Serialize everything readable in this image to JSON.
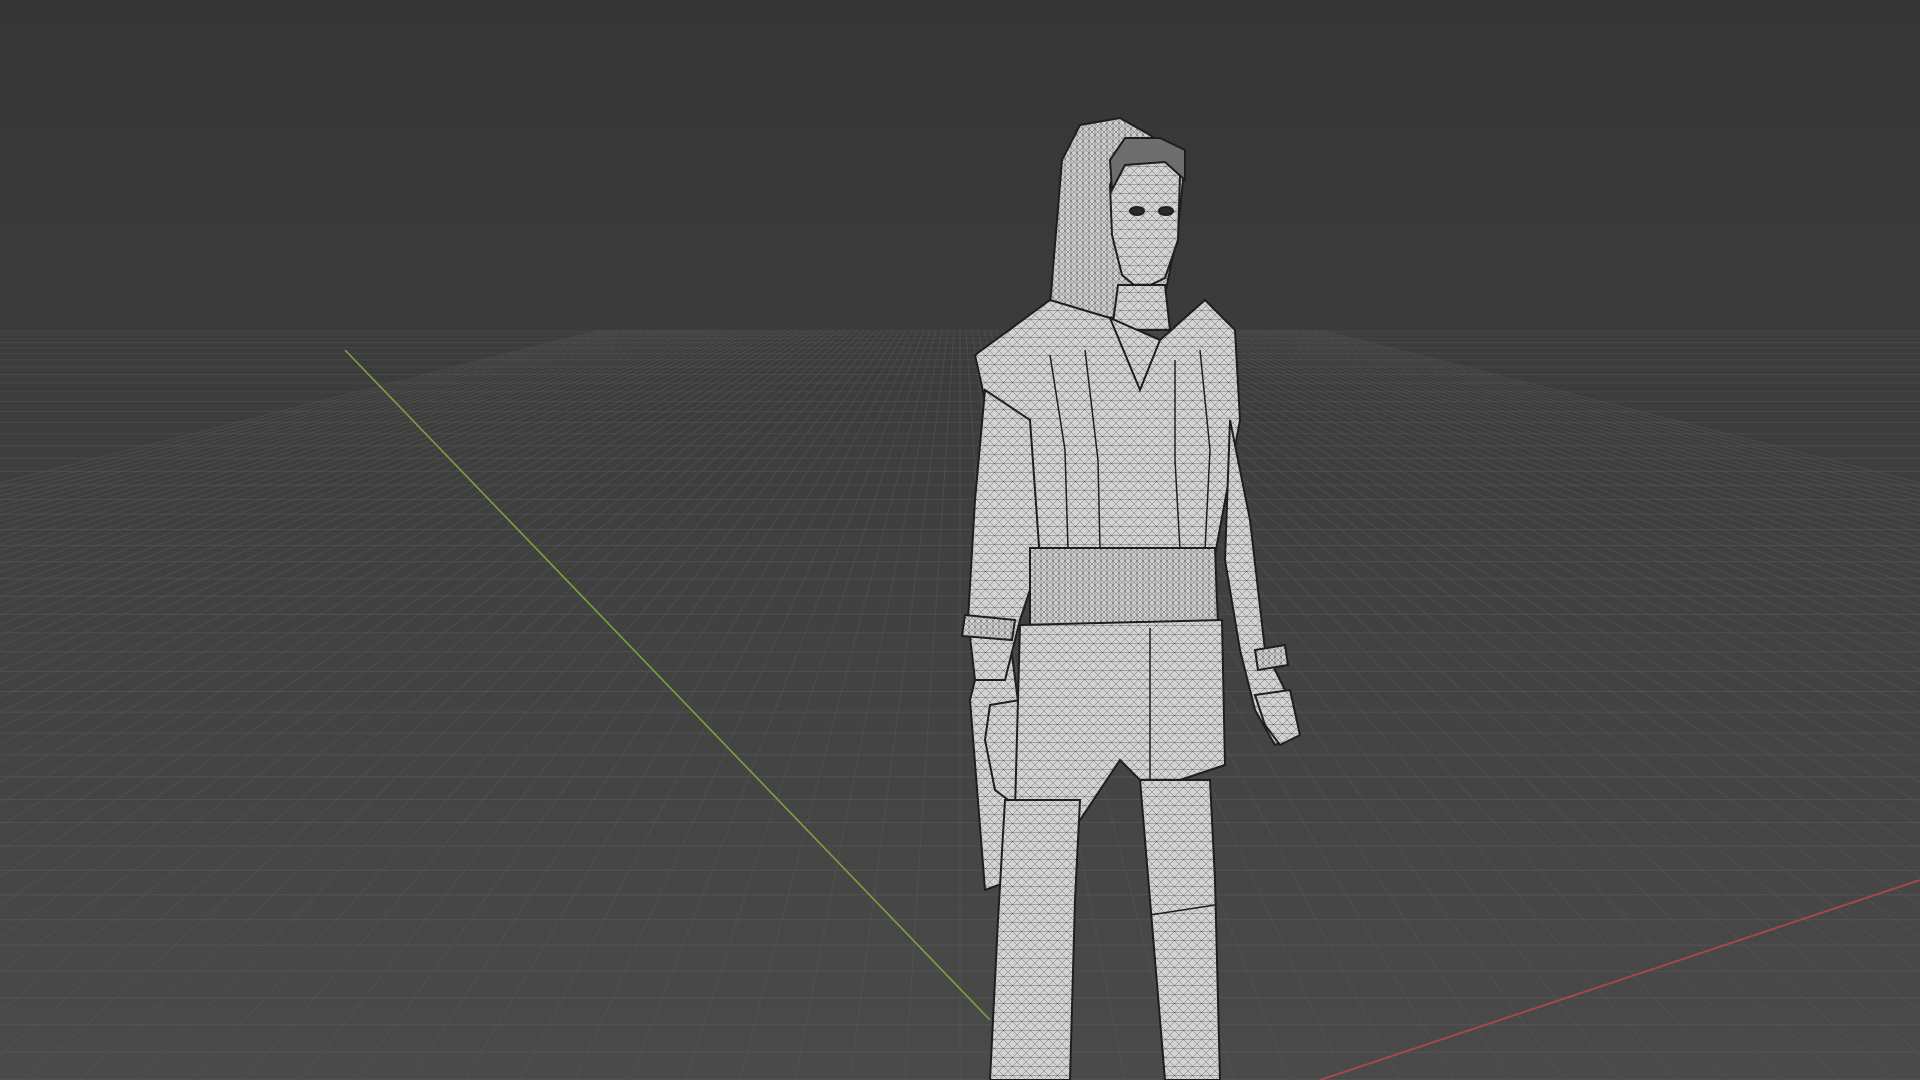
{
  "viewport": {
    "mode": "3d-viewport",
    "shading": "wireframe-overlay",
    "colors": {
      "background_top": "#353535",
      "background_bottom": "#4a4a4a",
      "grid_line": "#575757",
      "x_axis": "#b34a4a",
      "y_axis": "#7aa33a",
      "mesh_fill": "#d2d2d2",
      "mesh_wire": "#1e1e1e"
    }
  },
  "scene": {
    "object": {
      "icon": "human-character-icon",
      "kind": "character-mesh"
    }
  }
}
